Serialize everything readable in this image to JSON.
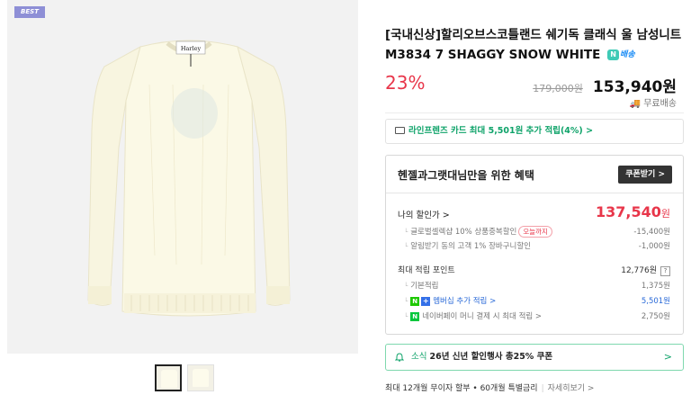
{
  "badge": {
    "best": "BEST"
  },
  "product": {
    "title": "[국내신상]할리오브스코틀랜드 쉐기독 클래식 울 남성니트 M3834 7 SHAGGY SNOW WHITE",
    "delivery_badge": "배송",
    "discount_rate": "23%",
    "original_price": "179,000원",
    "sale_price": "153,940원",
    "shipping": "무료배송",
    "sweater_tag": "Harley"
  },
  "card_benefit": {
    "text": "라인프렌즈 카드 최대 5,501원 추가 적립(4%) >"
  },
  "benefit": {
    "title": "헨젤과그랫대님만을 위한 혜택",
    "coupon_button": "쿠폰받기 >",
    "my_price_label": "나의 할인가 >",
    "my_price_value": "137,540",
    "my_price_unit": "원",
    "discounts": [
      {
        "label": "글로벌셀렉샵 10% 상품중복할인",
        "badge": "오늘까지",
        "value": "-15,400원"
      },
      {
        "label": "알림받기 동의 고객 1% 장바구니할인",
        "value": "-1,000원"
      }
    ],
    "points_label": "최대 적립 포인트",
    "points_value": "12,776원",
    "points_help": "?",
    "point_items": [
      {
        "label": "기본적립",
        "value": "1,375원"
      },
      {
        "label": "멤버십 추가 적립 >",
        "value": "5,501원"
      },
      {
        "label": "네이버페이 머니 결제 시 최대 적립 >",
        "value": "2,750원"
      }
    ]
  },
  "news": {
    "prefix": "소식",
    "text": "26년 신년 할인행사 총25% 쿠폰",
    "chevron": ">"
  },
  "installment": {
    "text": "최대 12개월 무이자 할부 • 60개월 특별금리",
    "more": "자세히보기 >"
  },
  "colors": {
    "accent_red": "#e8364a",
    "naver_green": "#0fa36a",
    "link_blue": "#2a6ad8",
    "badge_purple": "#8e8fd6"
  }
}
